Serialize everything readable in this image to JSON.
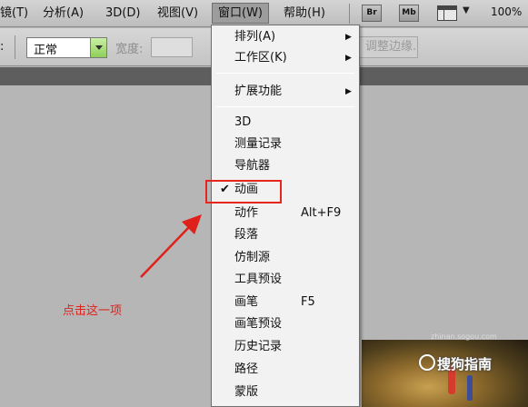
{
  "menubar": {
    "items": [
      {
        "label": "镜(T)"
      },
      {
        "label": "分析(A)"
      },
      {
        "label": "3D(D)"
      },
      {
        "label": "视图(V)"
      },
      {
        "label": "窗口(W)"
      },
      {
        "label": "帮助(H)"
      }
    ],
    "bridge_label": "Br",
    "minibridge_label": "Mb",
    "zoom": "100%"
  },
  "options": {
    "colon": ":",
    "style_value": "正常",
    "width_label": "宽度:",
    "refine_edge": "调整边缘..."
  },
  "dropdown": {
    "items": [
      {
        "label": "排列(A)"
      },
      {
        "label": "工作区(K)"
      },
      {
        "label": "扩展功能"
      },
      {
        "label": "3D"
      },
      {
        "label": "测量记录"
      },
      {
        "label": "导航器"
      },
      {
        "label": "动画",
        "check": "✔"
      },
      {
        "label": "动作",
        "shortcut": "Alt+F9"
      },
      {
        "label": "段落"
      },
      {
        "label": "仿制源"
      },
      {
        "label": "工具预设"
      },
      {
        "label": "画笔",
        "shortcut": "F5"
      },
      {
        "label": "画笔预设"
      },
      {
        "label": "历史记录"
      },
      {
        "label": "路径"
      },
      {
        "label": "蒙版"
      }
    ]
  },
  "annotation": {
    "text": "点击这一项",
    "color": "#e0201a"
  },
  "watermark": {
    "text": "搜狗指南",
    "url": "zhinan.sogou.com"
  },
  "colors": {
    "accent_red": "#e8251d",
    "green_select": "#8fcf5a"
  }
}
